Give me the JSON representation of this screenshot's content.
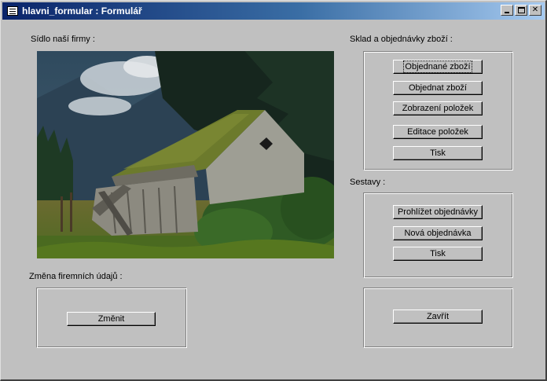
{
  "window": {
    "title": "hlavni_formular : Formulář"
  },
  "labels": {
    "headquarters": "Sídlo naší firmy :",
    "stock_orders": "Sklad a objednávky zboží :",
    "reports": "Sestavy :",
    "company_change": "Změna firemních údajů :"
  },
  "stock_buttons": {
    "ordered_goods": "Objednané zboží",
    "order_goods": "Objednat zboží",
    "show_items": "Zobrazení položek",
    "edit_items": "Editace položek",
    "print": "Tisk"
  },
  "report_buttons": {
    "view_orders": "Prohlížet objednávky",
    "new_order": "Nová objednávka",
    "print": "Tisk"
  },
  "change_button": "Změnit",
  "close_button": "Zavřít",
  "photo": {
    "icon": "old-wooden-house-photo",
    "sky_color": "#3a5468",
    "grass_color": "#5f7a2e",
    "moss_color": "#6c7a2c",
    "wall_color": "#a8a8a0"
  },
  "colors": {
    "face": "#c0c0c0",
    "title_active": "#0a246a"
  }
}
